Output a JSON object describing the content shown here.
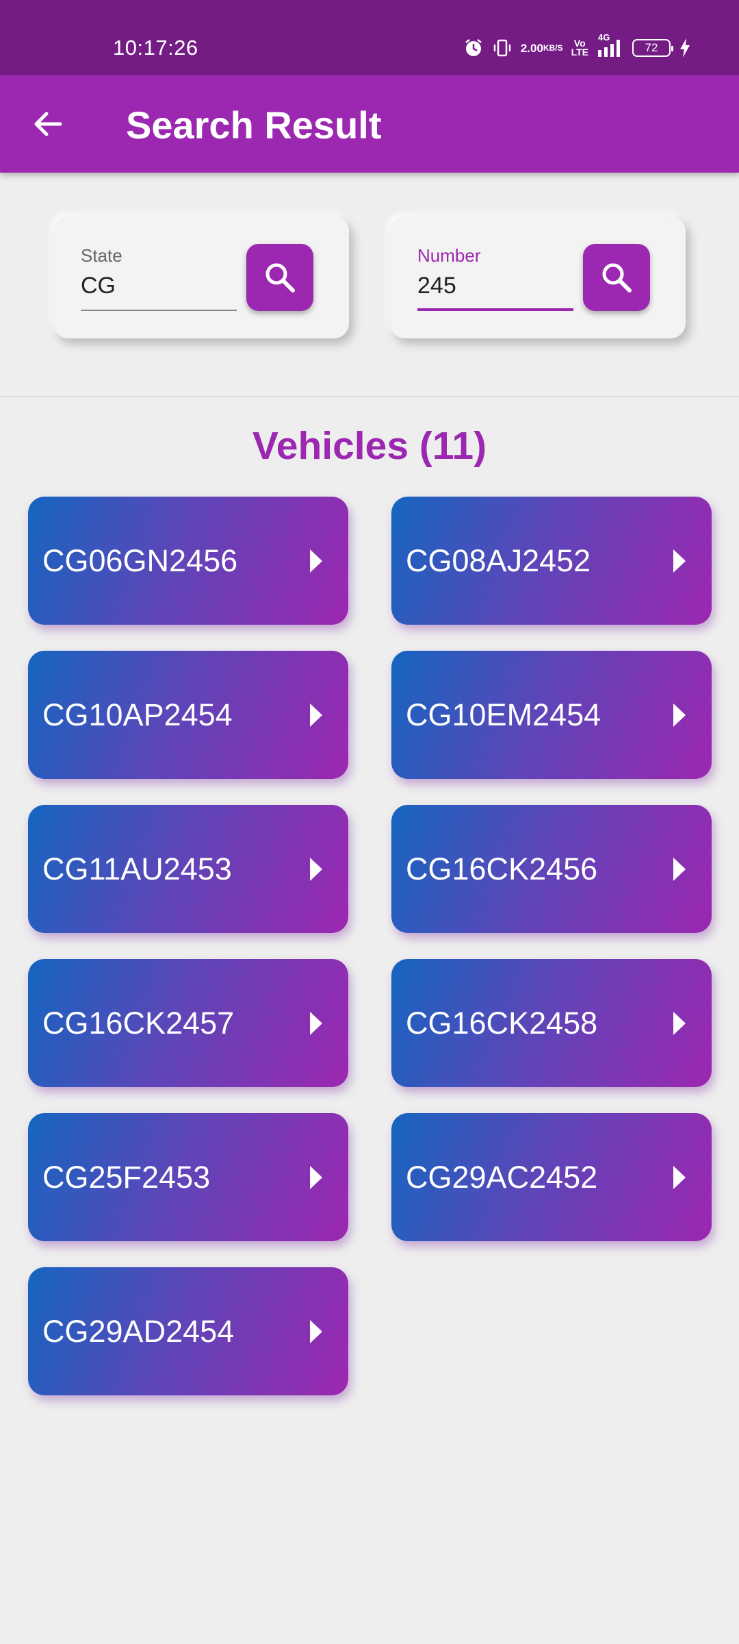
{
  "status_bar": {
    "time": "10:17:26",
    "net_speed": "2.00",
    "net_unit": "KB/S",
    "volte_top": "Vo",
    "volte_bottom": "LTE",
    "network": "4G",
    "battery": "72"
  },
  "app_bar": {
    "title": "Search Result",
    "back_icon": "arrow-left-icon"
  },
  "search": {
    "state": {
      "label": "State",
      "value": "CG"
    },
    "number": {
      "label": "Number",
      "value": "245"
    },
    "search_icon": "search-icon"
  },
  "results": {
    "heading": "Vehicles (11)",
    "vehicles": [
      "CG06GN2456",
      "CG08AJ2452",
      "CG10AP2454",
      "CG10EM2454",
      "CG11AU2453",
      "CG16CK2456",
      "CG16CK2457",
      "CG16CK2458",
      "CG25F2453",
      "CG29AC2452",
      "CG29AD2454"
    ]
  },
  "colors": {
    "status_bar": "#741c84",
    "primary": "#9c27b0",
    "gradient_start": "#1565c0",
    "gradient_end": "#9c27b0",
    "background": "#eeeeee"
  }
}
